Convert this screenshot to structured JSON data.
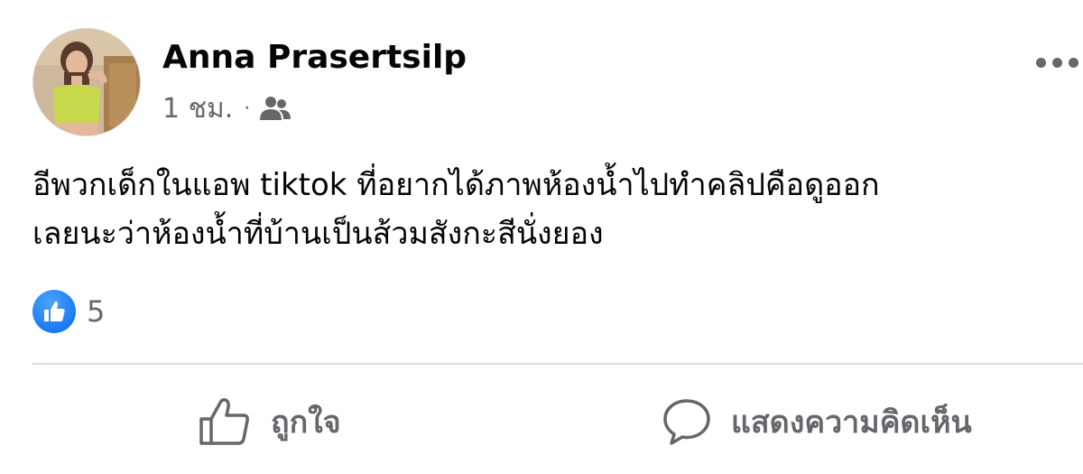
{
  "post": {
    "author": "Anna Prasertsilp",
    "time": "1 ชม.",
    "separator": "·",
    "audience_icon": "friends-icon",
    "more_icon": "more-options-icon",
    "text_line1": "อีพวกเด็กในแอพ tiktok ที่อยากได้ภาพห้องน้ำไปทำคลิปคือดูออก",
    "text_line2": "เลยนะว่าห้องน้ำที่บ้านเป็นส้วมสังกะสีนั่งยอง",
    "reaction_icon": "like-reaction-icon",
    "reaction_count": "5"
  },
  "actions": {
    "like_label": "ถูกใจ",
    "comment_label": "แสดงความคิดเห็น"
  },
  "colors": {
    "text": "#050505",
    "secondary": "#65676b",
    "like_blue": "#1877f2",
    "divider": "#dadde1"
  }
}
